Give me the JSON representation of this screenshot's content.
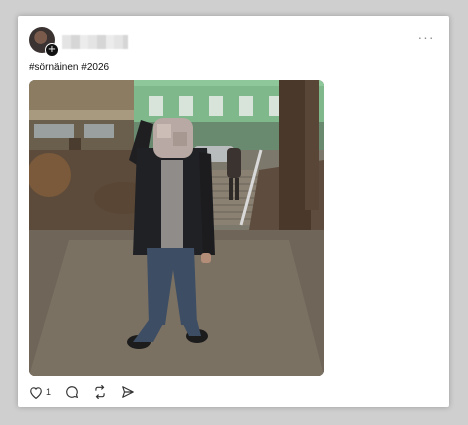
{
  "post": {
    "caption": "#sörnäinen #2026",
    "more_label": "···",
    "likes_count": "1"
  },
  "icons": {
    "more": "ellipsis-icon",
    "like": "heart-icon",
    "comment": "comment-icon",
    "repost": "repost-icon",
    "share": "send-icon",
    "follow": "plus-icon"
  },
  "colors": {
    "card_bg": "#ffffff",
    "page_bg": "#cfcfcf",
    "text": "#111111"
  }
}
